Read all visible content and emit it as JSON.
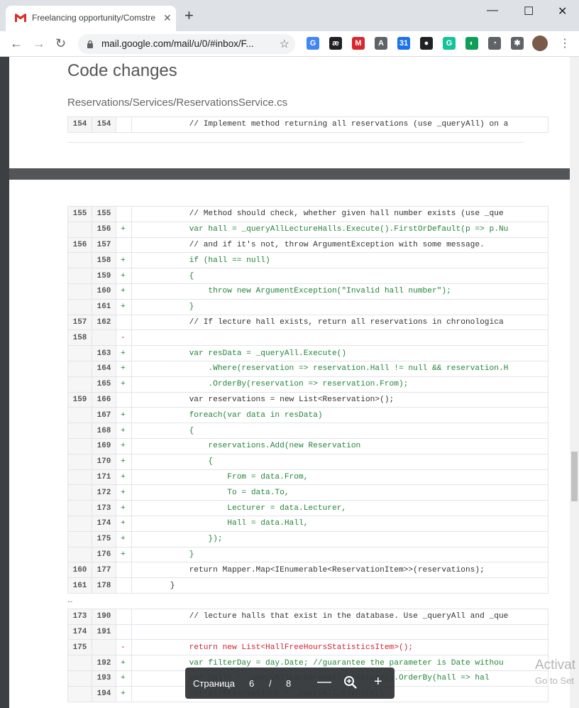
{
  "browser": {
    "tab_title": "Freelancing opportunity/Comstre",
    "tab_close": "✕",
    "new_tab": "+",
    "url": "mail.google.com/mail/u/0/#inbox/F...",
    "win_minimize": "—",
    "win_maximize": "☐",
    "win_close": "✕",
    "back": "←",
    "forward": "→",
    "reload": "↻",
    "star": "☆",
    "extensions": [
      {
        "icon": "translate-icon",
        "text": "G",
        "color": "#4285f4"
      },
      {
        "icon": "ae-icon",
        "text": "æ",
        "color": "#202124"
      },
      {
        "icon": "mega-icon",
        "text": "M",
        "color": "#d9272e"
      },
      {
        "icon": "translate-alt-icon",
        "text": "A",
        "color": "#5f6368"
      },
      {
        "icon": "calendar-icon",
        "text": "31",
        "color": "#1a73e8"
      },
      {
        "icon": "shield-dark-icon",
        "text": "●",
        "color": "#202124"
      },
      {
        "icon": "grammarly-icon",
        "text": "G",
        "color": "#15c39a"
      },
      {
        "icon": "edge-icon",
        "text": "◐",
        "color": "#0f9d58"
      },
      {
        "icon": "loop-icon",
        "text": "◔",
        "color": "#5f6368"
      },
      {
        "icon": "puzzle-icon",
        "text": "✱",
        "color": "#5f6368"
      }
    ],
    "menu": "⋮"
  },
  "doc": {
    "heading": "Code changes",
    "filename": "Reservations/Services/ReservationsService.cs",
    "top_rows": [
      {
        "old": "154",
        "new": "154",
        "type": "ctx",
        "mark": "",
        "code": "            // Implement method returning all reservations (use _queryAll) on a"
      }
    ],
    "rows": [
      {
        "old": "155",
        "new": "155",
        "type": "ctx",
        "mark": "",
        "code": "            // Method should check, whether given hall number exists (use _que"
      },
      {
        "old": "",
        "new": "156",
        "type": "add",
        "mark": "+",
        "code": "            var hall = _queryAllLectureHalls.Execute().FirstOrDefault(p => p.Nu"
      },
      {
        "old": "156",
        "new": "157",
        "type": "ctx",
        "mark": "",
        "code": "            // and if it's not, throw ArgumentException with some message."
      },
      {
        "old": "",
        "new": "158",
        "type": "add",
        "mark": "+",
        "code": "            if (hall == null)"
      },
      {
        "old": "",
        "new": "159",
        "type": "add",
        "mark": "+",
        "code": "            {"
      },
      {
        "old": "",
        "new": "160",
        "type": "add",
        "mark": "+",
        "code": "                throw new ArgumentException(\"Invalid hall number\");"
      },
      {
        "old": "",
        "new": "161",
        "type": "add",
        "mark": "+",
        "code": "            }"
      },
      {
        "old": "157",
        "new": "162",
        "type": "ctx",
        "mark": "",
        "code": "            // If lecture hall exists, return all reservations in chronologica"
      },
      {
        "old": "158",
        "new": "",
        "type": "del",
        "mark": "-",
        "code": ""
      },
      {
        "old": "",
        "new": "163",
        "type": "add",
        "mark": "+",
        "code": "            var resData = _queryAll.Execute()"
      },
      {
        "old": "",
        "new": "164",
        "type": "add",
        "mark": "+",
        "code": "                .Where(reservation => reservation.Hall != null && reservation.H"
      },
      {
        "old": "",
        "new": "165",
        "type": "add",
        "mark": "+",
        "code": "                .OrderBy(reservation => reservation.From);"
      },
      {
        "old": "159",
        "new": "166",
        "type": "ctx",
        "mark": "",
        "code": "            var reservations = new List<Reservation>();"
      },
      {
        "old": "",
        "new": "167",
        "type": "add",
        "mark": "+",
        "code": "            foreach(var data in resData)"
      },
      {
        "old": "",
        "new": "168",
        "type": "add",
        "mark": "+",
        "code": "            {"
      },
      {
        "old": "",
        "new": "169",
        "type": "add",
        "mark": "+",
        "code": "                reservations.Add(new Reservation"
      },
      {
        "old": "",
        "new": "170",
        "type": "add",
        "mark": "+",
        "code": "                {"
      },
      {
        "old": "",
        "new": "171",
        "type": "add",
        "mark": "+",
        "code": "                    From = data.From,"
      },
      {
        "old": "",
        "new": "172",
        "type": "add",
        "mark": "+",
        "code": "                    To = data.To,"
      },
      {
        "old": "",
        "new": "173",
        "type": "add",
        "mark": "+",
        "code": "                    Lecturer = data.Lecturer,"
      },
      {
        "old": "",
        "new": "174",
        "type": "add",
        "mark": "+",
        "code": "                    Hall = data.Hall,"
      },
      {
        "old": "",
        "new": "175",
        "type": "add",
        "mark": "+",
        "code": "                });"
      },
      {
        "old": "",
        "new": "176",
        "type": "add",
        "mark": "+",
        "code": "            }"
      },
      {
        "old": "160",
        "new": "177",
        "type": "ctx",
        "mark": "",
        "code": "            return Mapper.Map<IEnumerable<ReservationItem>>(reservations);"
      },
      {
        "old": "161",
        "new": "178",
        "type": "ctx",
        "mark": "",
        "code": "        }"
      }
    ],
    "ellipsis": "…",
    "rows2": [
      {
        "old": "173",
        "new": "190",
        "type": "ctx",
        "mark": "",
        "code": "            // lecture halls that exist in the database. Use _queryAll and _que"
      },
      {
        "old": "174",
        "new": "191",
        "type": "ctx",
        "mark": "",
        "code": ""
      },
      {
        "old": "175",
        "new": "",
        "type": "del",
        "mark": "-",
        "code": "            return new List<HallFreeHoursStatisticsItem>();"
      },
      {
        "old": "",
        "new": "192",
        "type": "add",
        "mark": "+",
        "code": "            var filterDay = day.Date; //guarantee the parameter is Date withou"
      },
      {
        "old": "",
        "new": "193",
        "type": "add",
        "mark": "+",
        "code": "            var halls = _queryAllLectureHalls.Execute().OrderBy(hall => hal"
      },
      {
        "old": "",
        "new": "194",
        "type": "add",
        "mark": "+",
        "code": "            var allReservations = _queryAll.Execute()"
      }
    ]
  },
  "pdf_toolbar": {
    "page_label": "Страница",
    "current_page": "6",
    "separator": "/",
    "total_pages": "8",
    "zoom_out": "—",
    "zoom_in": "+"
  },
  "watermark": {
    "line1": "Activat",
    "line2": "Go to Set"
  }
}
